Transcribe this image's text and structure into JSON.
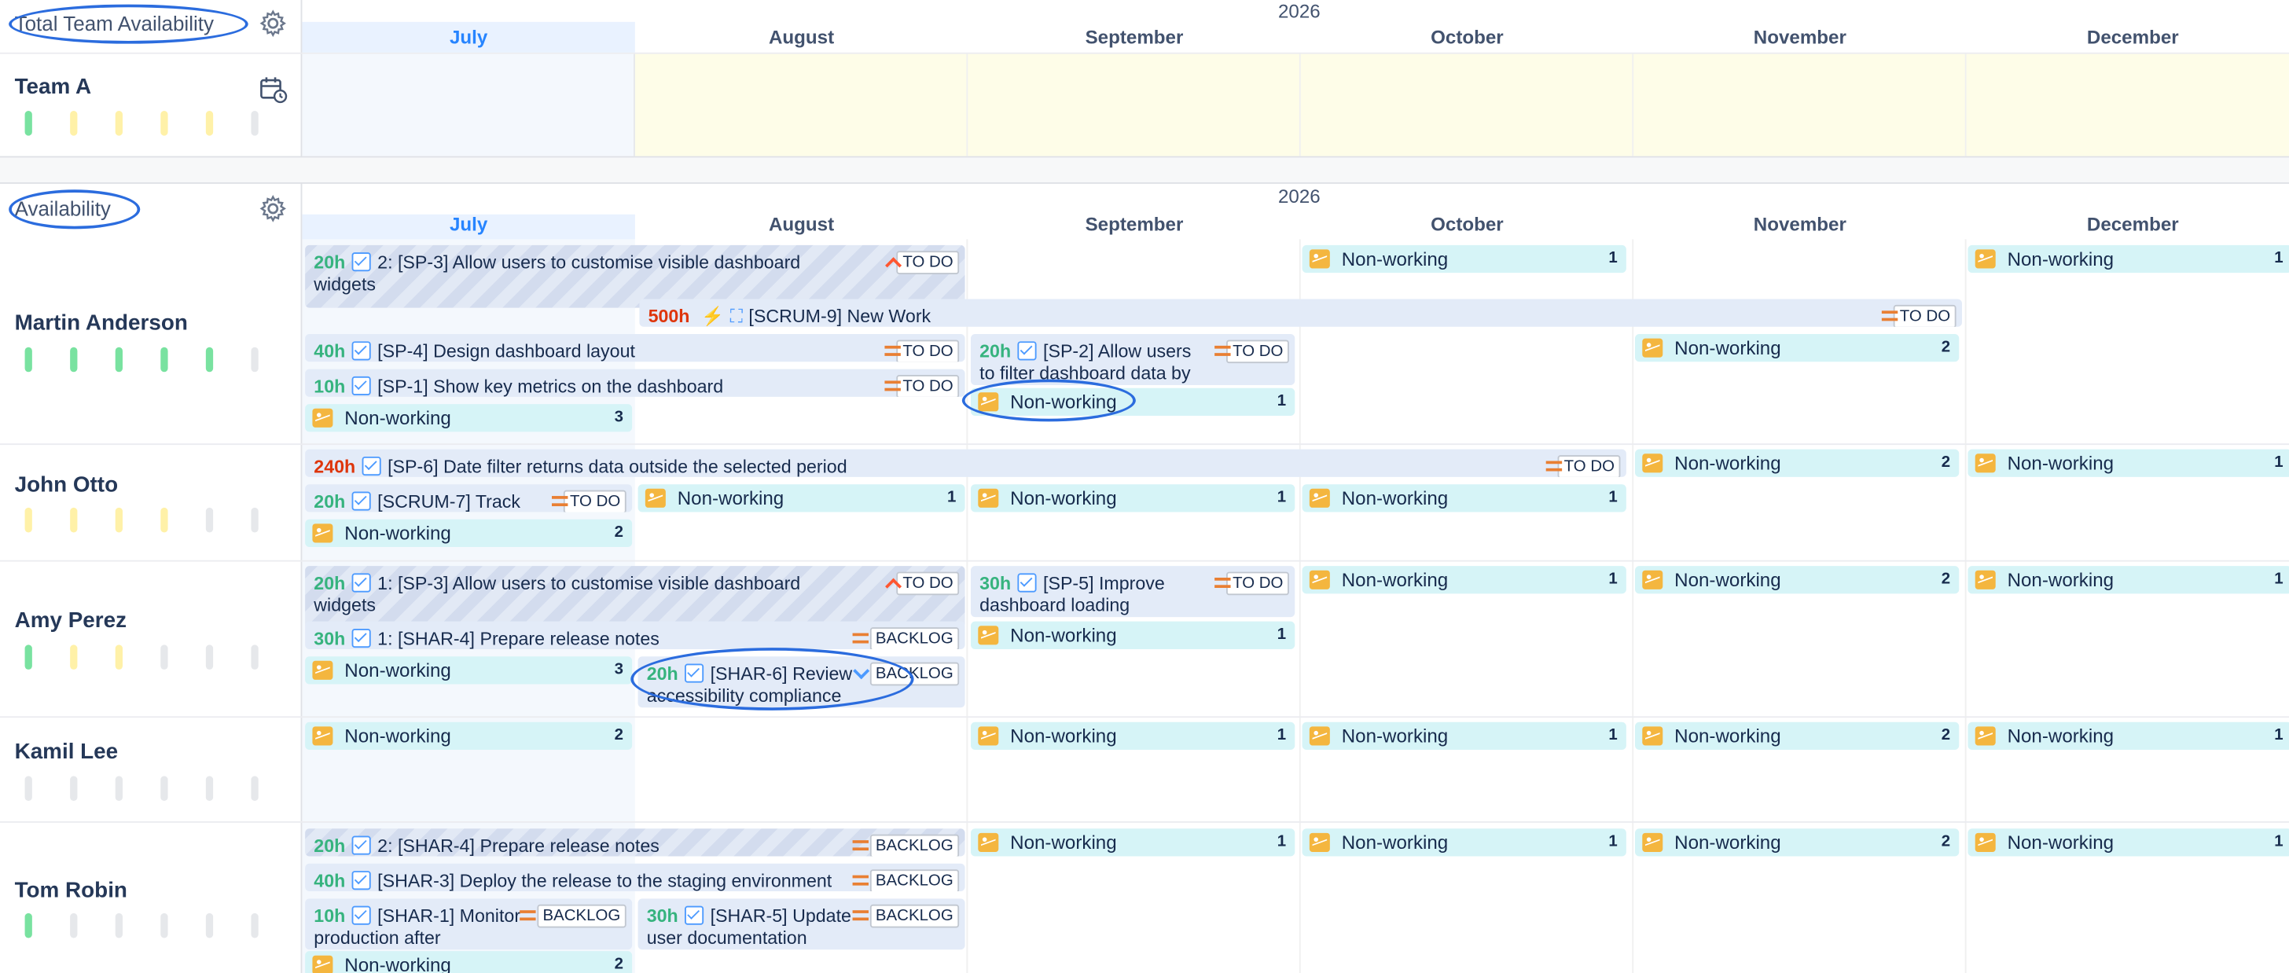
{
  "app": {
    "accent": "#2684ff"
  },
  "total": {
    "title": "Total Team Availability",
    "year": "2026",
    "months": [
      "July",
      "August",
      "September",
      "October",
      "November",
      "December"
    ],
    "team_name": "Team A",
    "dot_colors": [
      "#79e2a0",
      "#fff1a8",
      "#fff1a8",
      "#fff1a8",
      "#fff1a8",
      "#e6e8eb"
    ]
  },
  "avail": {
    "title": "Availability",
    "year": "2026",
    "months": [
      "July",
      "August",
      "September",
      "October",
      "November",
      "December"
    ]
  },
  "users": [
    {
      "name": "Martin Anderson",
      "dots": [
        "#79e2a0",
        "#79e2a0",
        "#79e2a0",
        "#79e2a0",
        "#79e2a0",
        "#e6e8eb"
      ]
    },
    {
      "name": "John Otto",
      "dots": [
        "#fff1a8",
        "#fff1a8",
        "#fff1a8",
        "#fff1a8",
        "#e6e8eb",
        "#e6e8eb"
      ]
    },
    {
      "name": "Amy Perez",
      "dots": [
        "#79e2a0",
        "#fff1a8",
        "#fff1a8",
        "#e6e8eb",
        "#e6e8eb",
        "#e6e8eb"
      ]
    },
    {
      "name": "Kamil Lee",
      "dots": [
        "#e6e8eb",
        "#e6e8eb",
        "#e6e8eb",
        "#e6e8eb",
        "#e6e8eb",
        "#e6e8eb"
      ]
    },
    {
      "name": "Tom Robin",
      "dots": [
        "#79e2a0",
        "#e6e8eb",
        "#e6e8eb",
        "#e6e8eb",
        "#e6e8eb",
        "#e6e8eb"
      ]
    }
  ],
  "tasks": [
    {
      "hours": "20h",
      "text": "2: [SP-3] Allow users to customise visible dashboard widgets",
      "status": "TO DO",
      "priority": "up",
      "striped": true
    },
    {
      "hours": "500h",
      "text": "[SCRUM-9] New Work",
      "status": "TO DO",
      "priority": "medium"
    },
    {
      "hours": "40h",
      "text": "[SP-4] Design dashboard layout",
      "status": "TO DO",
      "priority": "medium"
    },
    {
      "hours": "10h",
      "text": "[SP-1] Show key metrics on the dashboard",
      "status": "TO DO",
      "priority": "medium"
    },
    {
      "hours": "20h",
      "text": "[SP-2] Allow users to filter dashboard data by",
      "status": "TO DO",
      "priority": "medium"
    },
    {
      "hours": "240h",
      "text": "[SP-6] Date filter returns data outside the selected period",
      "status": "TO DO",
      "priority": "medium"
    },
    {
      "hours": "20h",
      "text": "[SCRUM-7] Track",
      "status": "TO DO",
      "priority": "medium"
    },
    {
      "hours": "20h",
      "text": "1: [SP-3] Allow users to customise visible dashboard widgets",
      "status": "TO DO",
      "priority": "up",
      "striped": true
    },
    {
      "hours": "30h",
      "text": "[SP-5] Improve dashboard loading",
      "status": "TO DO",
      "priority": "medium"
    },
    {
      "hours": "30h",
      "text": "1: [SHAR-4] Prepare release notes",
      "status": "BACKLOG",
      "priority": "medium"
    },
    {
      "hours": "20h",
      "text": "[SHAR-6] Review accessibility compliance",
      "status": "BACKLOG",
      "priority": "down"
    },
    {
      "hours": "20h",
      "text": "2: [SHAR-4] Prepare release notes",
      "status": "BACKLOG",
      "priority": "medium",
      "striped": true
    },
    {
      "hours": "40h",
      "text": "[SHAR-3] Deploy the release to the staging environment",
      "status": "BACKLOG",
      "priority": "medium"
    },
    {
      "hours": "10h",
      "text": "[SHAR-1] Monitor production after",
      "status": "BACKLOG",
      "priority": "medium"
    },
    {
      "hours": "30h",
      "text": "[SHAR-5] Update user documentation",
      "status": "BACKLOG",
      "priority": "medium"
    }
  ],
  "non_working": {
    "label": "Non-working",
    "counts": [
      "1",
      "1",
      "2",
      "3",
      "1",
      "2",
      "1",
      "1",
      "1",
      "2",
      "1",
      "1",
      "1",
      "2",
      "1",
      "3",
      "1",
      "2",
      "1",
      "1",
      "1",
      "2",
      "1",
      "1",
      "1",
      "2",
      "1",
      "2"
    ]
  }
}
